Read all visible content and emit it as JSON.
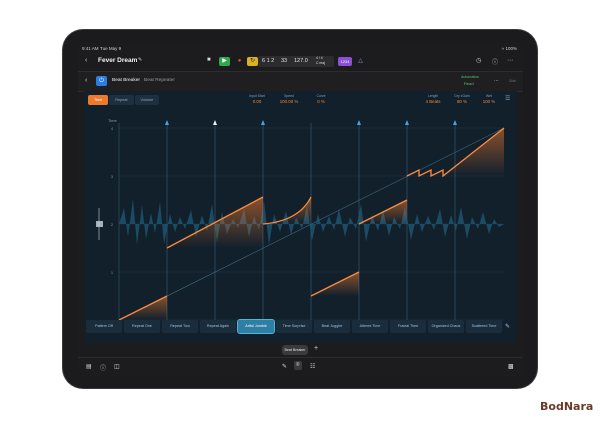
{
  "status_bar": {
    "time": "9:41 AM",
    "date": "Tue May 9",
    "battery": "100%"
  },
  "toolbar": {
    "project_title": "Fever Dream",
    "lcd": {
      "bars": "6 1 2",
      "beat": "33",
      "tempo": "127.0",
      "sig": "4 / 4",
      "key": "C maj"
    },
    "count_in": "1234",
    "accent_colors": {
      "play": "#2fa84f",
      "record": "#e34b3d",
      "cycle": "#d9b21f",
      "countin": "#8a4fd6"
    }
  },
  "plugin_header": {
    "name": "Beat Breaker",
    "preset": "Beat Repeater",
    "automation_label": "Automation",
    "automation_value": "Read",
    "side_label": "Side"
  },
  "plugin": {
    "tabs": [
      "Time",
      "Repeat",
      "Volume"
    ],
    "active_tab": "Time",
    "params_center": [
      {
        "label": "Input Start",
        "value": "0.00"
      },
      {
        "label": "Speed",
        "value": "100.00 %"
      },
      {
        "label": "Curve",
        "value": "0 %"
      }
    ],
    "params_right": [
      {
        "label": "Length",
        "value": "4 Beats"
      },
      {
        "label": "Dry ±Gain",
        "value": "80 %"
      },
      {
        "label": "Wet",
        "value": "100 %"
      }
    ],
    "graph": {
      "time_label": "Time",
      "y_ticks": [
        "4",
        "3",
        "2",
        "1"
      ],
      "x_ticks": [
        "1",
        "2",
        "3",
        "4"
      ]
    },
    "presets": [
      "Pattern Off",
      "Repeat One",
      "Repeat Two",
      "Repeat Again",
      "Artful Jumble",
      "Time Surprise",
      "Beat Juggler",
      "Altered Time",
      "Fractal Time",
      "Organized Chaos",
      "Scattered Time"
    ],
    "active_preset": "Artful Jumble"
  },
  "plugin_tab": {
    "label": "Beat Breaker"
  },
  "watermark": "BodNara"
}
